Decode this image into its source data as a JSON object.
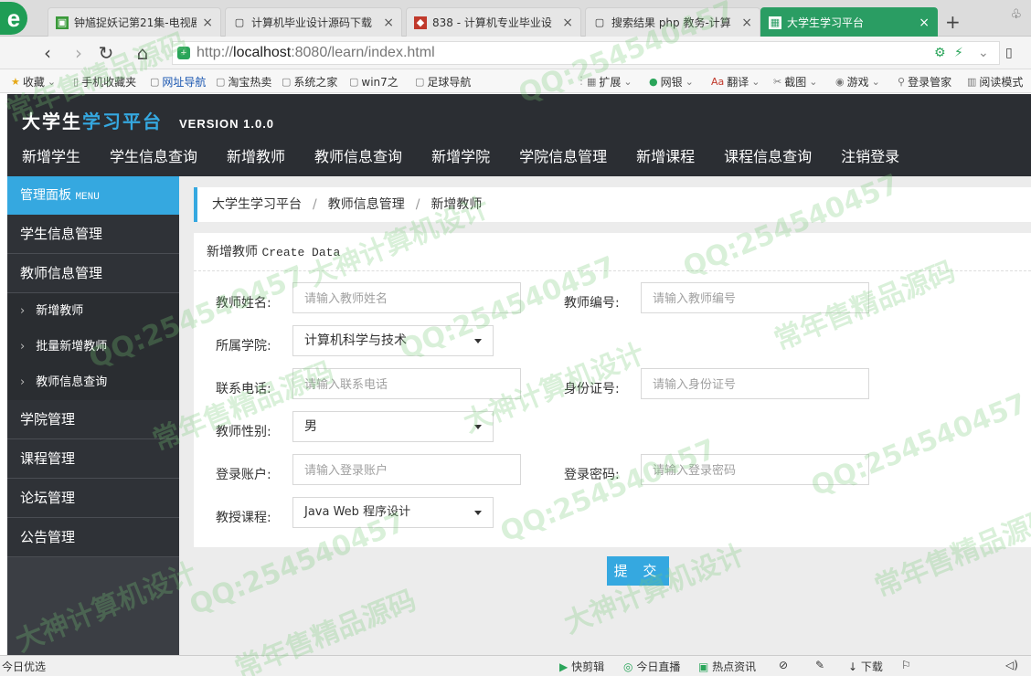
{
  "browser": {
    "tabs": [
      {
        "title": "钟馗捉妖记第21集-电视剧",
        "active": false
      },
      {
        "title": "计算机毕业设计源码下载",
        "active": false
      },
      {
        "title": "838 - 计算机专业毕业设",
        "active": false
      },
      {
        "title": "搜索结果 php 教务-计算",
        "active": false
      },
      {
        "title": "大学生学习平台",
        "active": true
      }
    ],
    "url": {
      "scheme": "http://",
      "host": "localhost",
      "path": ":8080/learn/index.html"
    },
    "bookmarks": [
      "收藏",
      "手机收藏夹",
      "网址导航",
      "淘宝热卖",
      "系统之家",
      "win7之",
      "足球导航"
    ],
    "toolbar_right": [
      "扩展",
      "网银",
      "翻译",
      "截图",
      "游戏",
      "登录管家",
      "阅读模式"
    ]
  },
  "app": {
    "brand_part1": "大学生",
    "brand_part2": "学习平台",
    "version": "VERSION 1.0.0",
    "top_nav": [
      "新增学生",
      "学生信息查询",
      "新增教师",
      "教师信息查询",
      "新增学院",
      "学院信息管理",
      "新增课程",
      "课程信息查询",
      "注销登录"
    ]
  },
  "sidebar": {
    "head": "管理面板",
    "head_en": "MENU",
    "groups": [
      {
        "label": "学生信息管理"
      },
      {
        "label": "教师信息管理"
      }
    ],
    "sub_items": [
      "新增教师",
      "批量新增教师",
      "教师信息查询"
    ],
    "groups_after": [
      "学院管理",
      "课程管理",
      "论坛管理",
      "公告管理"
    ]
  },
  "breadcrumb": [
    "大学生学习平台",
    "教师信息管理",
    "新增教师"
  ],
  "form": {
    "title": "新增教师",
    "title_en": "Create Data",
    "name_label": "教师姓名:",
    "name_placeholder": "请输入教师姓名",
    "number_label": "教师编号:",
    "number_placeholder": "请输入教师编号",
    "college_label": "所属学院:",
    "college_value": "计算机科学与技术",
    "phone_label": "联系电话:",
    "phone_placeholder": "请输入联系电话",
    "idcard_label": "身份证号:",
    "idcard_placeholder": "请输入身份证号",
    "gender_label": "教师性别:",
    "gender_value": "男",
    "account_label": "登录账户:",
    "account_placeholder": "请输入登录账户",
    "password_label": "登录密码:",
    "password_placeholder": "请输入登录密码",
    "course_label": "教授课程:",
    "course_value": "Java Web 程序设计",
    "submit_label": "提 交"
  },
  "statusbar": {
    "left": "今日优选",
    "right": [
      "快剪辑",
      "今日直播",
      "热点资讯",
      "下载"
    ]
  },
  "watermark": [
    "QQ:254540457",
    "大神计算机设计",
    "常年售精品源码"
  ],
  "colors": {
    "accent": "#35a8e0",
    "header": "#2b2e33",
    "active_tab": "#2a9d63"
  }
}
